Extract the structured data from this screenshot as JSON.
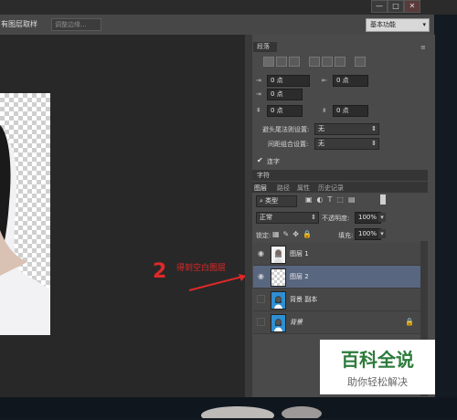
{
  "toolbar": {
    "sample_all_layers": "有图层取样",
    "refine_edge": "调整边缘...",
    "workspace": "基本功能"
  },
  "window_buttons": {
    "min": "—",
    "max": "□",
    "close": "✕"
  },
  "paragraph_panel": {
    "tab": "段落",
    "indent_left": "0 点",
    "indent_right": "0 点",
    "indent_first": "0 点",
    "space_before": "0 点",
    "space_after": "0 点",
    "kinsoku_label": "避头尾法则设置:",
    "kinsoku_value": "无",
    "mojikumi_label": "间距组合设置:",
    "mojikumi_value": "无",
    "hyphenate": "连字"
  },
  "char_tab": "字符",
  "layers_panel": {
    "tabs": [
      "图层",
      "路径",
      "属性",
      "历史记录"
    ],
    "filter_kind": "类型",
    "blend_mode": "正常",
    "opacity_label": "不透明度:",
    "opacity_value": "100%",
    "lock_label": "锁定:",
    "fill_label": "填充:",
    "fill_value": "100%",
    "layers": [
      {
        "name": "图层 1",
        "visible": true,
        "selected": false
      },
      {
        "name": "图层 2",
        "visible": true,
        "selected": true
      },
      {
        "name": "背景 副本",
        "visible": false,
        "selected": false
      },
      {
        "name": "背景",
        "visible": false,
        "selected": false
      }
    ]
  },
  "annotation": {
    "number": "2",
    "text": "得到空白图层"
  },
  "watermark": {
    "title": "百科全说",
    "subtitle": "助你轻松解决"
  },
  "colors": {
    "accent_annotation": "#e02828",
    "selected_layer": "#596680",
    "logo_green": "#2c7b3b"
  }
}
